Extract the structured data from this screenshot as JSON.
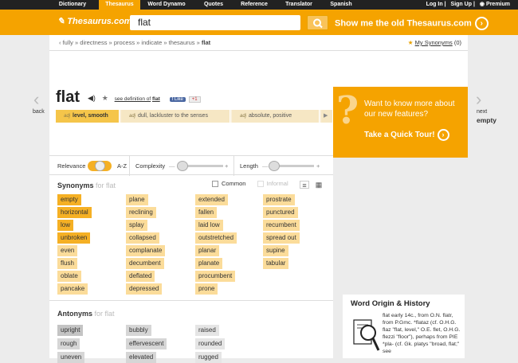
{
  "topnav": {
    "tabs": [
      "Dictionary",
      "Thesaurus",
      "Word Dynamo",
      "Quotes",
      "Reference",
      "Translator",
      "Spanish"
    ],
    "active": "Thesaurus",
    "login": "Log In",
    "signup": "Sign Up",
    "premium": "Premium"
  },
  "header": {
    "logo": "Thesaurus.com",
    "search_value": "flat",
    "search_icon": "search-icon",
    "old_link": "Show me the old Thesaurus.com",
    "accent": "#f5a300"
  },
  "breadcrumb": {
    "items": [
      "fully",
      "directness",
      "process",
      "indicate",
      "thesaurus"
    ],
    "current": "flat"
  },
  "my_synonyms": {
    "label": "My Synonyms",
    "count": "(0)"
  },
  "nav": {
    "back_label": "back",
    "next_label": "next",
    "next_word": "empty"
  },
  "entry": {
    "word": "flat",
    "see_definition_prefix": "see definition of",
    "see_definition_word": "flat",
    "like": "Like",
    "plus": "+1"
  },
  "senses": [
    {
      "pos": "adj",
      "label": "level, smooth"
    },
    {
      "pos": "adj",
      "label": "dull, lackluster to the senses"
    },
    {
      "pos": "adj",
      "label": "absolute, positive"
    }
  ],
  "sliders": {
    "relevance": "Relevance",
    "az": "A-Z",
    "complexity": "Complexity",
    "length": "Length"
  },
  "synonyms": {
    "title": "Synonyms",
    "for_word": "for flat",
    "option_common": "Common",
    "option_informal": "Informal",
    "columns": [
      [
        {
          "w": "empty",
          "r": 0
        },
        {
          "w": "horizontal",
          "r": 0
        },
        {
          "w": "low",
          "r": 0
        },
        {
          "w": "unbroken",
          "r": 0
        },
        {
          "w": "even",
          "r": 1
        },
        {
          "w": "flush",
          "r": 1
        },
        {
          "w": "oblate",
          "r": 1
        },
        {
          "w": "pancake",
          "r": 1
        }
      ],
      [
        {
          "w": "plane",
          "r": 1
        },
        {
          "w": "reclining",
          "r": 1
        },
        {
          "w": "splay",
          "r": 1
        },
        {
          "w": "collapsed",
          "r": 1
        },
        {
          "w": "complanate",
          "r": 1
        },
        {
          "w": "decumbent",
          "r": 1
        },
        {
          "w": "deflated",
          "r": 1
        },
        {
          "w": "depressed",
          "r": 1
        }
      ],
      [
        {
          "w": "extended",
          "r": 1
        },
        {
          "w": "fallen",
          "r": 1
        },
        {
          "w": "laid low",
          "r": 1
        },
        {
          "w": "outstretched",
          "r": 1
        },
        {
          "w": "planar",
          "r": 1
        },
        {
          "w": "planate",
          "r": 1
        },
        {
          "w": "procumbent",
          "r": 1
        },
        {
          "w": "prone",
          "r": 1
        }
      ],
      [
        {
          "w": "prostrate",
          "r": 1
        },
        {
          "w": "punctured",
          "r": 1
        },
        {
          "w": "recumbent",
          "r": 1
        },
        {
          "w": "spread out",
          "r": 1
        },
        {
          "w": "supine",
          "r": 1
        },
        {
          "w": "tabular",
          "r": 1
        }
      ]
    ]
  },
  "antonyms": {
    "title": "Antonyms",
    "for_word": "for flat",
    "columns": [
      [
        "upright",
        "rough",
        "uneven"
      ],
      [
        "bubbly",
        "effervescent",
        "elevated"
      ],
      [
        "raised",
        "rounded",
        "rugged"
      ]
    ]
  },
  "promo": {
    "text": "Want to know more about our new features?",
    "cta": "Take a Quick Tour!"
  },
  "origin": {
    "title": "Word Origin & History",
    "text": "flat early 14c., from O.N. flatr, from P.Gmc. *flataz (cf. O.H.G. flaz \"flat, level,\" O.E. flet, O.H.G. flezzi \"floor\"), perhaps from PIE *pla- (cf. Gk. platys \"broad, flat;\" see"
  }
}
